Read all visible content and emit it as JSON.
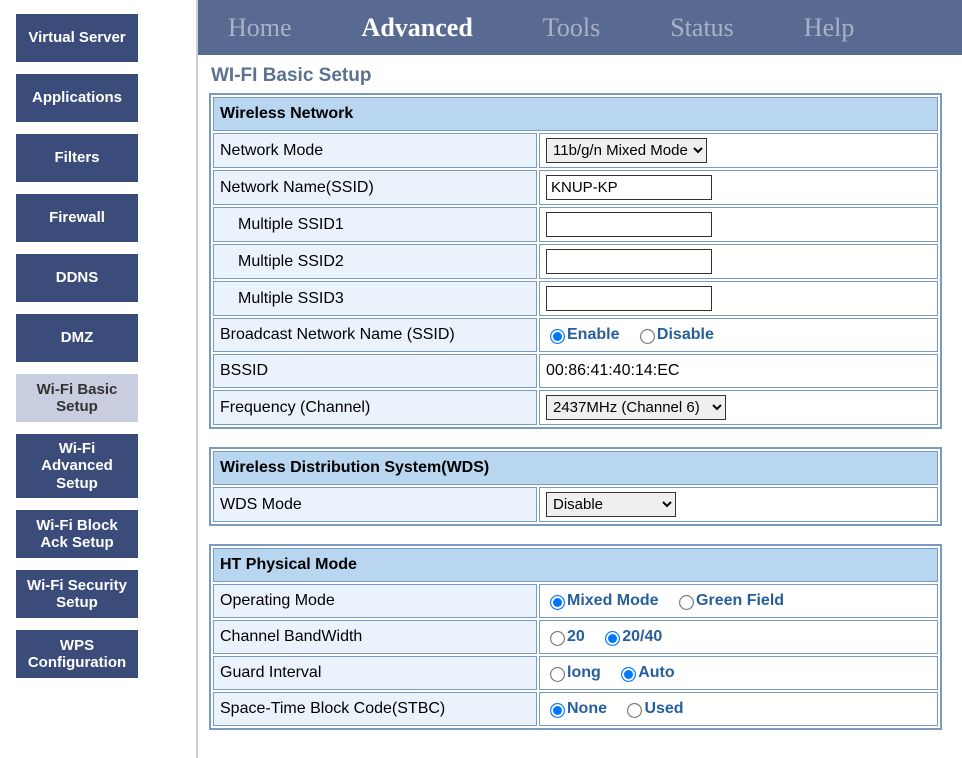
{
  "sidebar": {
    "items": [
      {
        "label": "Virtual Server",
        "active": false
      },
      {
        "label": "Applications",
        "active": false
      },
      {
        "label": "Filters",
        "active": false
      },
      {
        "label": "Firewall",
        "active": false
      },
      {
        "label": "DDNS",
        "active": false
      },
      {
        "label": "DMZ",
        "active": false
      },
      {
        "label": "Wi-Fi Basic Setup",
        "active": true
      },
      {
        "label": "Wi-Fi Advanced Setup",
        "active": false
      },
      {
        "label": "Wi-Fi Block Ack Setup",
        "active": false
      },
      {
        "label": "Wi-Fi Security Setup",
        "active": false
      },
      {
        "label": "WPS Configuration",
        "active": false
      }
    ]
  },
  "topnav": {
    "items": [
      {
        "label": "Home",
        "active": false
      },
      {
        "label": "Advanced",
        "active": true
      },
      {
        "label": "Tools",
        "active": false
      },
      {
        "label": "Status",
        "active": false
      },
      {
        "label": "Help",
        "active": false
      }
    ]
  },
  "page": {
    "title": "WI-FI Basic Setup"
  },
  "wireless_network": {
    "header": "Wireless Network",
    "network_mode_label": "Network Mode",
    "network_mode_value": "11b/g/n Mixed Mode",
    "ssid_label": "Network Name(SSID)",
    "ssid_value": "KNUP-KP",
    "mssid1_label": "Multiple SSID1",
    "mssid1_value": "",
    "mssid2_label": "Multiple SSID2",
    "mssid2_value": "",
    "mssid3_label": "Multiple SSID3",
    "mssid3_value": "",
    "broadcast_label": "Broadcast Network Name (SSID)",
    "broadcast_enable": "Enable",
    "broadcast_disable": "Disable",
    "bssid_label": "BSSID",
    "bssid_value": "00:86:41:40:14:EC",
    "freq_label": "Frequency (Channel)",
    "freq_value": "2437MHz (Channel 6)"
  },
  "wds": {
    "header": "Wireless Distribution System(WDS)",
    "mode_label": "WDS Mode",
    "mode_value": "Disable"
  },
  "ht": {
    "header": "HT Physical Mode",
    "op_mode_label": "Operating Mode",
    "op_mixed": "Mixed Mode",
    "op_green": "Green Field",
    "cbw_label": "Channel BandWidth",
    "cbw_20": "20",
    "cbw_2040": "20/40",
    "gi_label": "Guard Interval",
    "gi_long": "long",
    "gi_auto": "Auto",
    "stbc_label": "Space-Time Block Code(STBC)",
    "stbc_none": "None",
    "stbc_used": "Used"
  }
}
